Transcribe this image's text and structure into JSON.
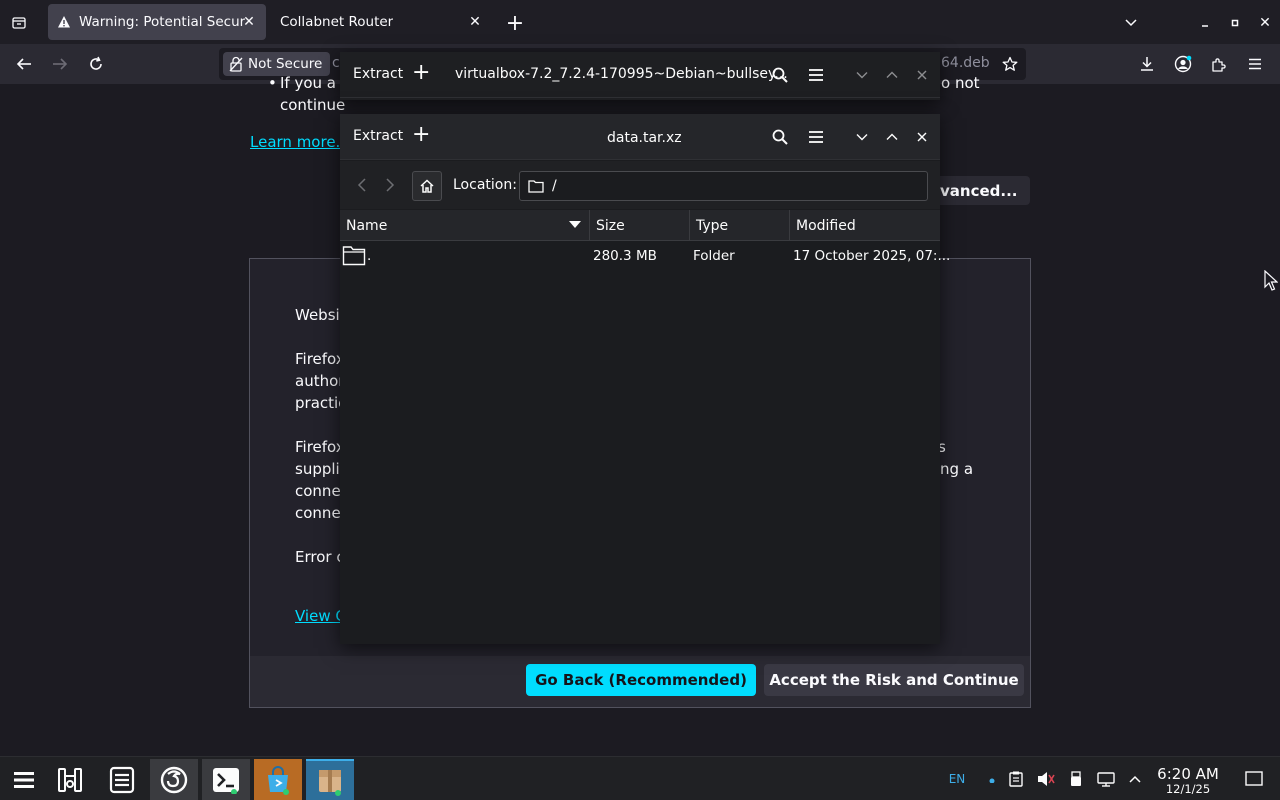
{
  "browser": {
    "tabs": [
      {
        "title": "Warning: Potential Security Risk Ahead",
        "active": true
      },
      {
        "title": "Collabnet Router",
        "active": false
      }
    ],
    "urlbar": {
      "security_label": "Not Secure",
      "url_prefix": "c",
      "url_tail": "64.deb"
    }
  },
  "page": {
    "bullet_line1": "If you a",
    "bullet_line1_tail": "o not",
    "bullet_line2": "continue",
    "learn_more": "Learn more...",
    "advanced_button": "vanced...",
    "adv_lines": [
      "Websit",
      "Firefox",
      "author",
      "practic",
      "Firefox",
      "suppli",
      "conne",
      "conne",
      "Error c"
    ],
    "adv_tail_1": "s",
    "adv_tail_2": "ting a",
    "view_cert": "View C",
    "go_back": "Go Back (Recommended)",
    "accept": "Accept the Risk and Continue"
  },
  "ark_back": {
    "extract": "Extract",
    "title": "virtualbox-7.2_7.2.4-170995~Debian~bullsey..."
  },
  "ark_front": {
    "extract": "Extract",
    "title": "data.tar.xz",
    "location_label": "Location:",
    "location_value": "/",
    "columns": [
      "Name",
      "Size",
      "Type",
      "Modified"
    ],
    "rows": [
      {
        "name": ".",
        "size": "280.3 MB",
        "type": "Folder",
        "modified": "17 October 2025, 07:..."
      }
    ]
  },
  "taskbar": {
    "lang": "EN",
    "time": "6:20 AM",
    "date": "12/1/25"
  },
  "colors": {
    "accent": "#00ddff",
    "ark_active": "#3daee9"
  }
}
